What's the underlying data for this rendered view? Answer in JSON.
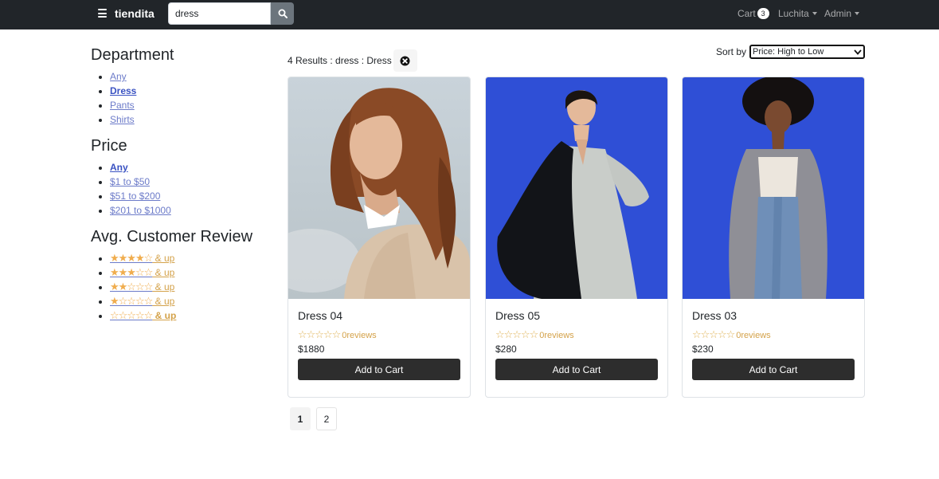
{
  "navbar": {
    "brand": "tiendita",
    "search_value": "dress",
    "cart_label": "Cart",
    "cart_count": "3",
    "user_label": "Luchita",
    "admin_label": "Admin"
  },
  "sidebar": {
    "department_heading": "Department",
    "departments": [
      "Any",
      "Dress",
      "Pants",
      "Shirts"
    ],
    "price_heading": "Price",
    "prices": [
      "Any",
      "$1 to $50",
      "$51 to $200",
      "$201 to $1000"
    ],
    "review_heading": "Avg. Customer Review",
    "review_suffix": " & up",
    "review_levels": [
      4,
      3,
      2,
      1,
      0
    ]
  },
  "results": {
    "summary": "4 Results : dress : Dress",
    "sort_label": "Sort by",
    "sort_value": "Price: High to Low"
  },
  "products": [
    {
      "name": "Dress 04",
      "reviews": "0reviews",
      "price": "$1880",
      "button": "Add to Cart"
    },
    {
      "name": "Dress 05",
      "reviews": "0reviews",
      "price": "$280",
      "button": "Add to Cart"
    },
    {
      "name": "Dress 03",
      "reviews": "0reviews",
      "price": "$230",
      "button": "Add to Cart"
    }
  ],
  "pagination": [
    "1",
    "2"
  ],
  "colors": {
    "navbar_bg": "#212529",
    "star": "#f0ad4e",
    "link": "#6c7bc9",
    "button_bg": "#2d2d2d",
    "photo_backdrop_blue": "#2f4fd6"
  }
}
